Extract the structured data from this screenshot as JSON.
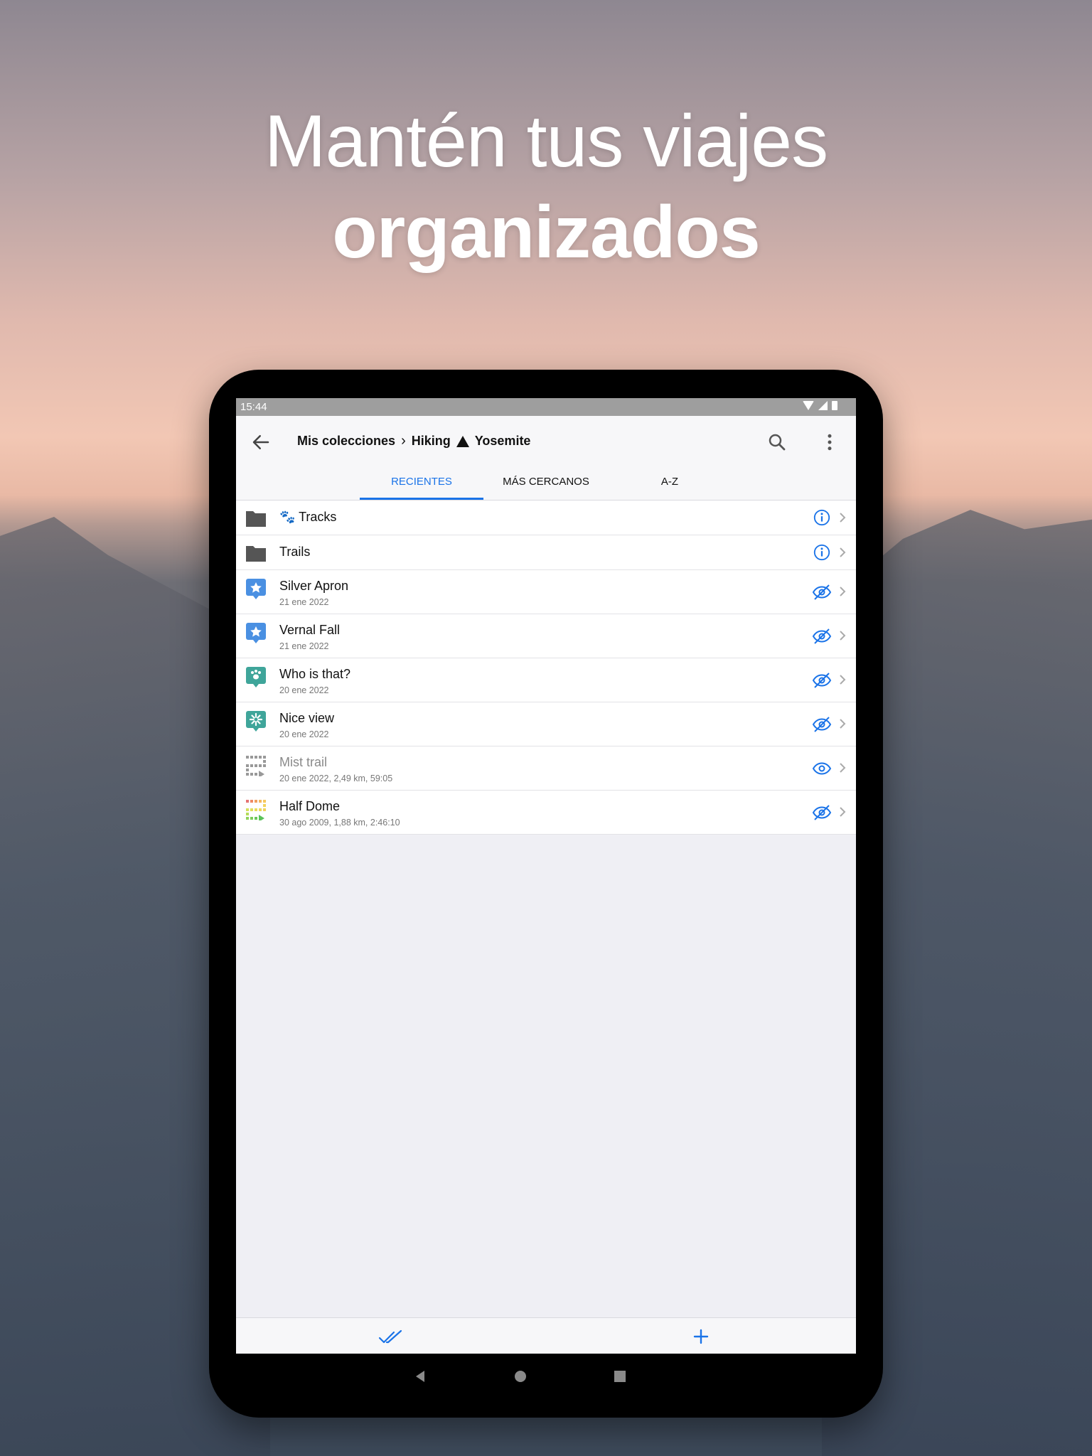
{
  "headline": {
    "line1": "Mantén tus viajes",
    "line2": "organizados"
  },
  "status": {
    "time": "15:44"
  },
  "appbar": {
    "breadcrumb": [
      "Mis colecciones",
      "Hiking",
      "Yosemite"
    ],
    "back_icon": "arrow-left-icon",
    "search_icon": "search-icon",
    "more_icon": "more-vert-icon"
  },
  "tabs": [
    {
      "label": "RECIENTES",
      "active": true
    },
    {
      "label": "MÁS CERCANOS",
      "active": false
    },
    {
      "label": "A-Z",
      "active": false
    }
  ],
  "items": [
    {
      "type": "folder",
      "title": "🐾 Tracks",
      "action": "info-icon"
    },
    {
      "type": "folder",
      "title": "Trails",
      "action": "info-icon"
    },
    {
      "type": "waypoint-star",
      "title": "Silver Apron",
      "subtitle": "21 ene 2022",
      "action": "eye-off-icon"
    },
    {
      "type": "waypoint-star",
      "title": "Vernal Fall",
      "subtitle": "21 ene 2022",
      "action": "eye-off-icon"
    },
    {
      "type": "waypoint-paw",
      "title": "Who is that?",
      "subtitle": "20 ene 2022",
      "action": "eye-off-icon"
    },
    {
      "type": "waypoint-flower",
      "title": "Nice view",
      "subtitle": "20 ene 2022",
      "action": "eye-off-icon"
    },
    {
      "type": "track-gray",
      "title": "Mist trail",
      "subtitle": "20 ene 2022, 2,49 km, 59:05",
      "action": "eye-icon"
    },
    {
      "type": "track-color",
      "title": "Half Dome",
      "subtitle": "30 ago 2009, 1,88 km, 2:46:10",
      "action": "eye-off-icon"
    }
  ],
  "colors": {
    "accent": "#1a73e8",
    "waypoint_blue": "#4a90e2",
    "waypoint_teal": "#3fa59a"
  },
  "bottombar": {
    "select_icon": "double-check-icon",
    "add_icon": "plus-icon"
  },
  "system_nav": [
    "back-triangle-icon",
    "home-circle-icon",
    "recents-square-icon"
  ]
}
